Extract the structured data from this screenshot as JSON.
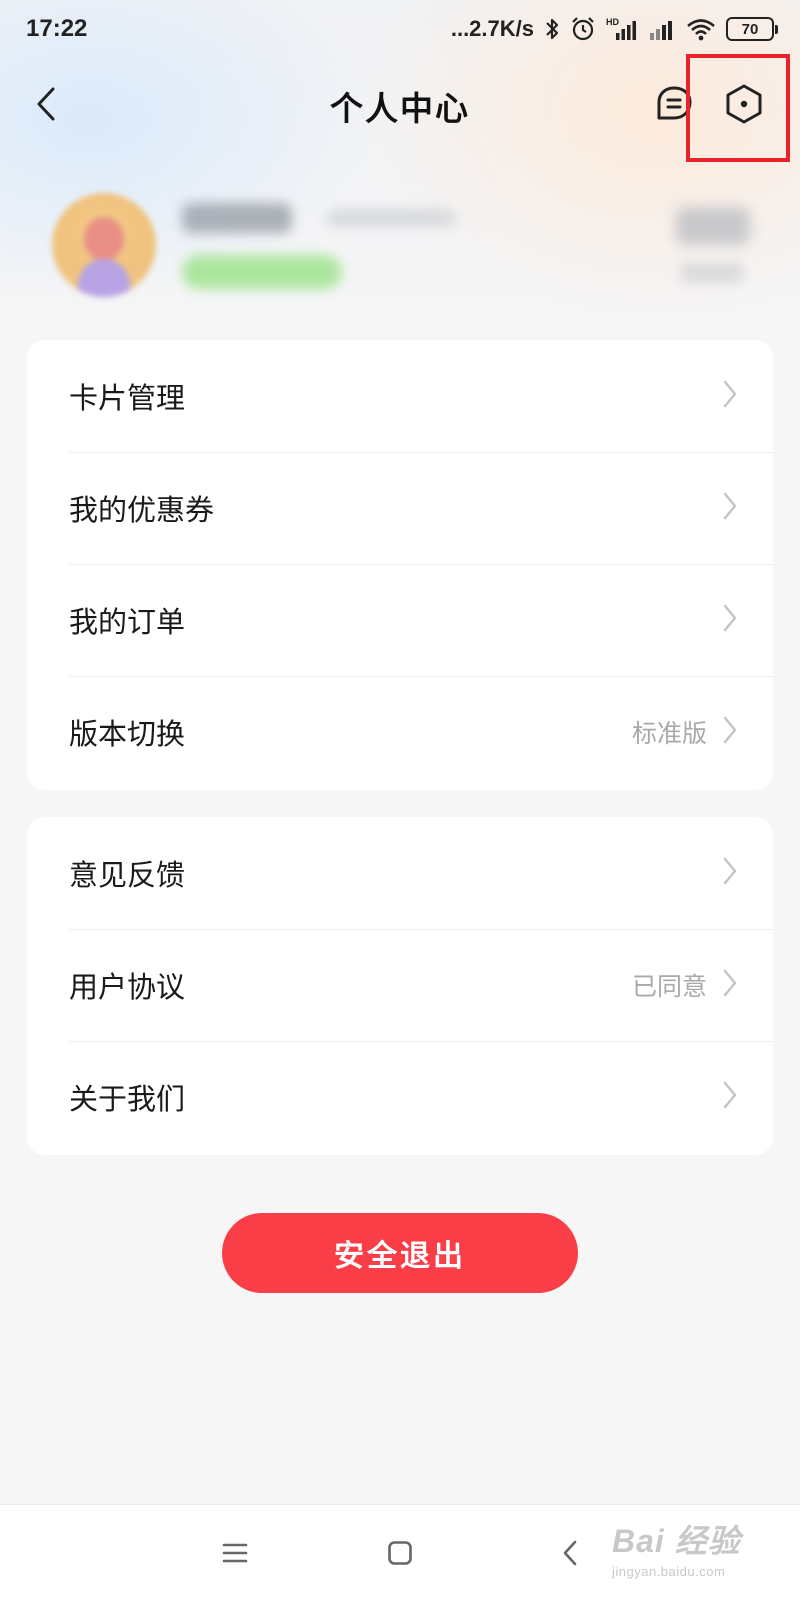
{
  "status_bar": {
    "time": "17:22",
    "network_speed": "...2.7K/s",
    "battery": "70",
    "icons": [
      "bluetooth-icon",
      "alarm-icon",
      "hd-signal-icon",
      "signal-icon",
      "wifi-icon",
      "battery-icon"
    ]
  },
  "header": {
    "title": "个人中心",
    "back_icon": "chevron-left-icon",
    "message_icon": "message-bubble-icon",
    "settings_icon": "hexagon-settings-icon",
    "highlight_color": "#e8242a"
  },
  "menu_group_1": [
    {
      "label": "卡片管理",
      "value": ""
    },
    {
      "label": "我的优惠券",
      "value": ""
    },
    {
      "label": "我的订单",
      "value": ""
    },
    {
      "label": "版本切换",
      "value": "标准版"
    }
  ],
  "menu_group_2": [
    {
      "label": "意见反馈",
      "value": ""
    },
    {
      "label": "用户协议",
      "value": "已同意"
    },
    {
      "label": "关于我们",
      "value": ""
    }
  ],
  "logout": {
    "label": "安全退出",
    "color": "#fa3e47"
  },
  "nav_bar": {
    "icons": [
      "menu-icon",
      "home-square-icon",
      "back-triangle-icon"
    ]
  },
  "watermark": {
    "main": "Bai 经验",
    "sub": "jingyan.baidu.com"
  }
}
